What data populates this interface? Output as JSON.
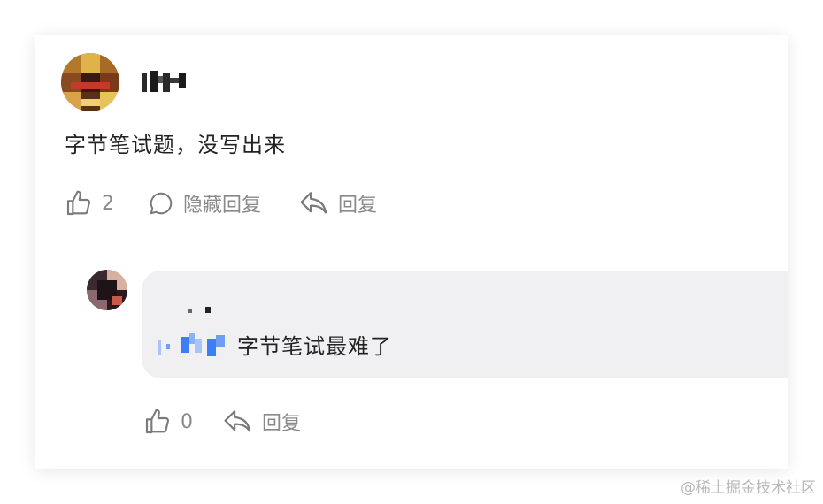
{
  "comment": {
    "text": "字节笔试题，没写出来",
    "likes": "2",
    "hide_replies_label": "隐藏回复",
    "reply_label": "回复"
  },
  "reply": {
    "text": "字节笔试最难了",
    "likes": "0",
    "reply_label": "回复"
  },
  "watermark": "@稀土掘金技术社区",
  "icons": [
    "thumbs-up-icon",
    "comment-bubble-icon",
    "reply-arrow-icon"
  ],
  "colors": {
    "text": "#222222",
    "muted": "#8a8a8a",
    "bubble": "#f0f0f2",
    "mention": "#3d7df5"
  }
}
